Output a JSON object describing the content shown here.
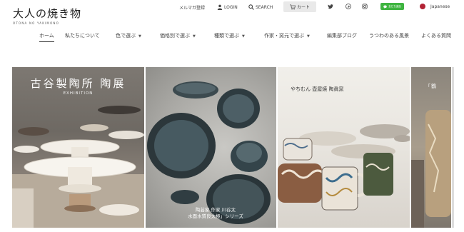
{
  "logo": {
    "jp": "大人の焼き物",
    "en": "OTONA NO YAKIMONO"
  },
  "util": {
    "mail": "メルマガ登録",
    "login": "LOGIN",
    "search": "SEARCH",
    "cart": "カート",
    "line": "友だち追加",
    "language": "Japanese"
  },
  "nav": {
    "items": [
      {
        "label": "ホーム",
        "dropdown": false,
        "active": true
      },
      {
        "label": "私たちについて",
        "dropdown": false
      },
      {
        "label": "色で選ぶ",
        "dropdown": true
      },
      {
        "label": "価格別で選ぶ",
        "dropdown": true
      },
      {
        "label": "種類で選ぶ",
        "dropdown": true
      },
      {
        "label": "作家・窯元で選ぶ",
        "dropdown": true
      },
      {
        "label": "編集部ブログ",
        "dropdown": false
      },
      {
        "label": "うつわのある風景",
        "dropdown": false
      },
      {
        "label": "よくある質問",
        "dropdown": false
      }
    ]
  },
  "hero": {
    "panel1": {
      "title": "古谷製陶所 陶展",
      "subtitle": "EXHIBITION"
    },
    "panel2": {
      "caption_line1": "陶芸家 作家 川谷太",
      "caption_line2": "水面水質良太極」シリーズ"
    },
    "panel3": {
      "title": "やちむん 壺屋焼 陶眞窯"
    },
    "panel4": {
      "title": "「鶴"
    }
  },
  "colors": {
    "line_green": "#3fb440",
    "flag_red": "#b22234"
  }
}
